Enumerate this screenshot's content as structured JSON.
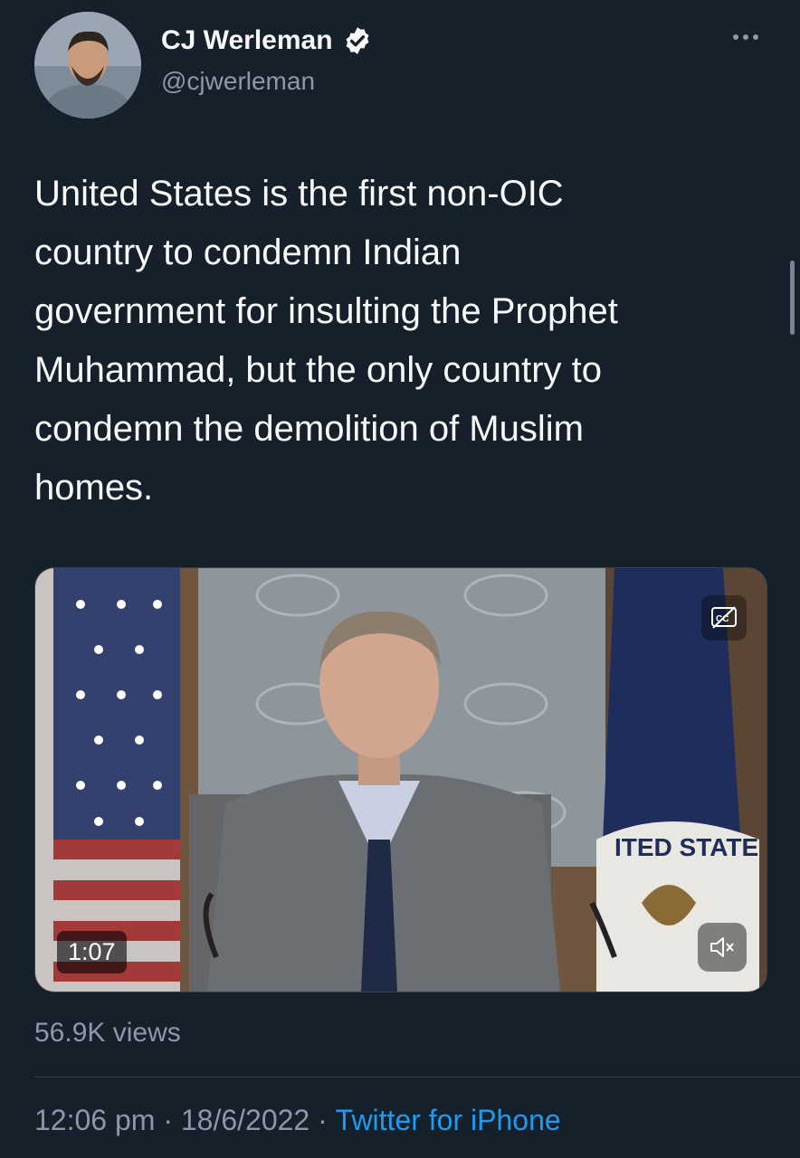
{
  "author": {
    "display_name": "CJ Werleman",
    "handle": "@cjwerleman",
    "verified": true,
    "avatar_icon": "profile-photo"
  },
  "tweet": {
    "text": "United States is the first non-OIC\ncountry to condemn Indian\ngovernment for insulting the Prophet\nMuhammad, but the only country to\ncondemn the demolition of Muslim\nhomes."
  },
  "media": {
    "type": "video",
    "duration": "1:07",
    "caption_icon": "closed-captions-off-icon",
    "mute_icon": "speaker-muted-icon",
    "seal_text": "ITED STATE"
  },
  "stats": {
    "views": "56.9K views"
  },
  "meta": {
    "time": "12:06 pm",
    "separator": " · ",
    "date": "18/6/2022",
    "source": "Twitter for iPhone"
  },
  "colors": {
    "background": "#15202b",
    "text_primary": "#f7f9f9",
    "text_secondary": "#8b98a5",
    "link": "#1d9bf0",
    "verified": "#f7f9f9"
  }
}
